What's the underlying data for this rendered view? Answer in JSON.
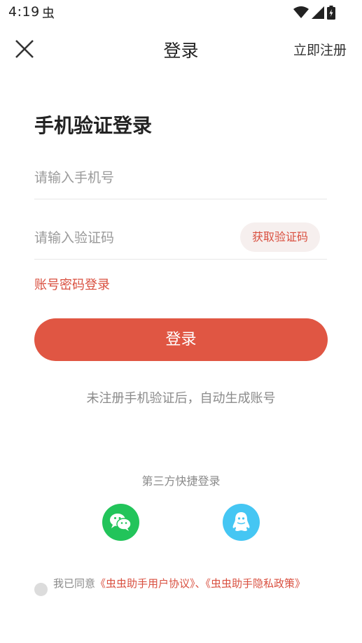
{
  "status_bar": {
    "time": "4:19",
    "app_icon_glyph": "虫",
    "wifi_icon": "wifi-icon",
    "signal_icon": "signal-icon",
    "battery_icon": "battery-charging-icon"
  },
  "header": {
    "close_icon": "close-icon",
    "title": "登录",
    "register_link": "立即注册"
  },
  "form": {
    "title": "手机验证登录",
    "phone_placeholder": "请输入手机号",
    "code_placeholder": "请输入验证码",
    "get_code_button": "获取验证码",
    "password_login_link": "账号密码登录",
    "login_button": "登录",
    "hint": "未注册手机验证后，自动生成账号"
  },
  "third_party": {
    "label": "第三方快捷登录",
    "wechat_icon": "wechat-icon",
    "qq_icon": "qq-icon"
  },
  "agreement": {
    "prefix": "我已同意",
    "user_agreement": "《虫虫助手用户协议》",
    "separator": "、",
    "privacy_policy": "《虫虫助手隐私政策》"
  },
  "colors": {
    "accent": "#e05643",
    "link_red": "#d94f3f",
    "wechat": "#22c45a",
    "qq": "#45c6f3"
  }
}
